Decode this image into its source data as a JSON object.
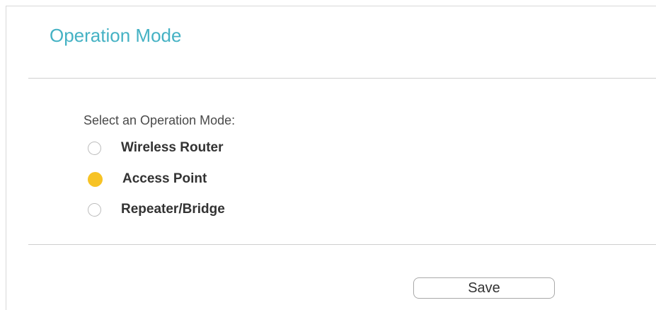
{
  "page": {
    "title": "Operation Mode"
  },
  "form": {
    "prompt": "Select an Operation Mode:",
    "options": [
      {
        "label": "Wireless Router",
        "selected": false
      },
      {
        "label": "Access Point",
        "selected": true
      },
      {
        "label": "Repeater/Bridge",
        "selected": false
      }
    ],
    "save_label": "Save"
  },
  "colors": {
    "title": "#45b2c4",
    "radio_selected": "#f7c325"
  }
}
